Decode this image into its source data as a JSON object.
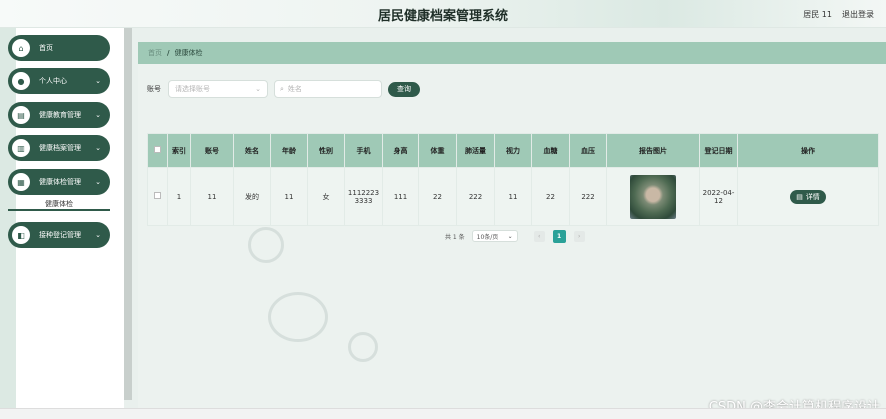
{
  "header": {
    "title": "居民健康档案管理系统",
    "user": "居民 11",
    "logout": "退出登录"
  },
  "sidebar": {
    "items": [
      {
        "label": "首页",
        "icon": "home-icon",
        "glyph": "⌂",
        "has_children": false
      },
      {
        "label": "个人中心",
        "icon": "person-icon",
        "glyph": "●",
        "has_children": true
      },
      {
        "label": "健康教育管理",
        "icon": "book-icon",
        "glyph": "▤",
        "has_children": true
      },
      {
        "label": "健康档案管理",
        "icon": "folder-icon",
        "glyph": "▥",
        "has_children": true
      },
      {
        "label": "健康体检管理",
        "icon": "grid-icon",
        "glyph": "▦",
        "has_children": true
      },
      {
        "label": "接种登记管理",
        "icon": "clipboard-icon",
        "glyph": "◧",
        "has_children": true
      }
    ],
    "subitem": {
      "label": "健康体检"
    },
    "chevron": "⌄"
  },
  "breadcrumb": {
    "home": "首页",
    "separator": "/",
    "current": "健康体检"
  },
  "search": {
    "account_label": "账号",
    "account_placeholder": "请选择账号",
    "name_placeholder": "姓名",
    "query_button": "查询"
  },
  "table": {
    "headers": [
      "索引",
      "账号",
      "姓名",
      "年龄",
      "性别",
      "手机",
      "身高",
      "体重",
      "肺活量",
      "视力",
      "血糖",
      "血压",
      "报告图片",
      "登记日期",
      "操作"
    ],
    "rows": [
      {
        "index": "1",
        "account": "11",
        "name": "发的",
        "age": "11",
        "gender": "女",
        "phone": "11122233333",
        "height": "111",
        "weight": "22",
        "vital_capacity": "222",
        "vision": "11",
        "blood_sugar": "22",
        "blood_pressure": "222",
        "date": "2022-04-12",
        "action": "详情"
      }
    ]
  },
  "pagination": {
    "total": "共 1 条",
    "page_size": "10条/页",
    "current_page": "1",
    "prev": "‹",
    "next": "›"
  },
  "watermark": "CSDN @李会计算机程序设计",
  "colors": {
    "primary": "#2f5a4a",
    "header_row": "#9fc9b6",
    "active_page": "#2aa198"
  }
}
